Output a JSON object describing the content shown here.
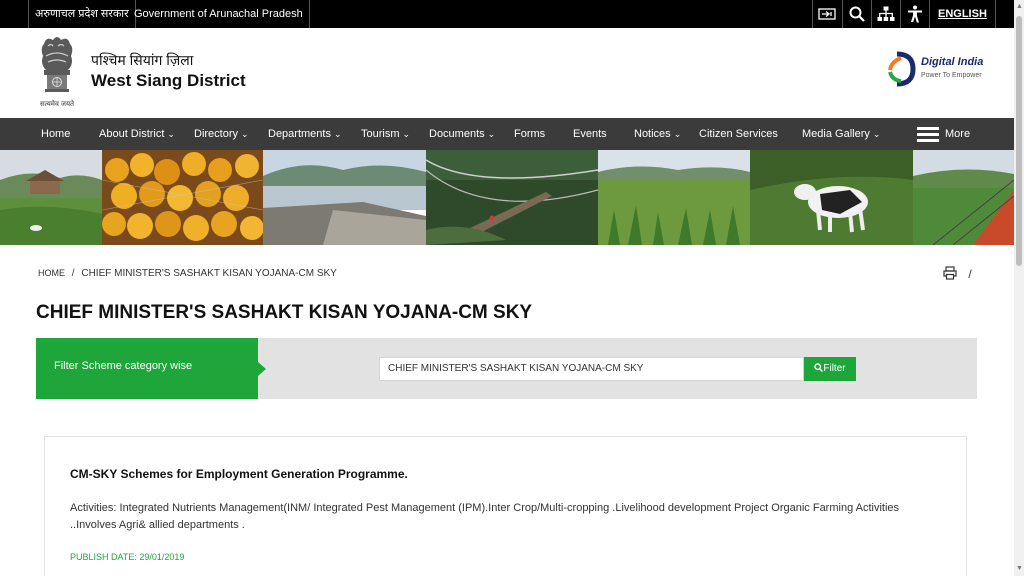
{
  "topbar": {
    "gov_hindi": "अरुणाचल प्रदेश सरकार",
    "gov_english": "Government of Arunachal Pradesh",
    "language": "ENGLISH",
    "tools": [
      "skip-to-content-icon",
      "search-icon",
      "sitemap-icon",
      "accessibility-icon"
    ]
  },
  "header": {
    "site_name_hindi": "पश्चिम सियांग ज़िला",
    "site_name_english": "West Siang District",
    "emblem_motto": "सत्यमेव जयते",
    "digital_india_title": "Digital India",
    "digital_india_tagline": "Power To Empower"
  },
  "nav": {
    "items": [
      {
        "label": "Home",
        "dropdown": false
      },
      {
        "label": "About District",
        "dropdown": true
      },
      {
        "label": "Directory",
        "dropdown": true
      },
      {
        "label": "Departments",
        "dropdown": true
      },
      {
        "label": "Tourism",
        "dropdown": true
      },
      {
        "label": "Documents",
        "dropdown": true
      },
      {
        "label": "Forms",
        "dropdown": false
      },
      {
        "label": "Events",
        "dropdown": false
      },
      {
        "label": "Notices",
        "dropdown": true
      },
      {
        "label": "Citizen Services",
        "dropdown": false
      },
      {
        "label": "Media Gallery",
        "dropdown": true
      }
    ],
    "more": "More",
    "chevron": "❯"
  },
  "breadcrumb": {
    "home": "HOME",
    "separator": "/",
    "current": "CHIEF MINISTER'S SASHAKT KISAN YOJANA-CM SKY"
  },
  "print_separator": "/",
  "page_title": "CHIEF MINISTER'S SASHAKT KISAN YOJANA-CM SKY",
  "filter": {
    "label": "Filter Scheme category wise",
    "value": "CHIEF MINISTER'S SASHAKT KISAN YOJANA-CM SKY",
    "button": "Filter"
  },
  "scheme": {
    "title": "CM-SKY Schemes for Employment Generation Programme.",
    "description": "Activities: Integrated Nutrients Management(INM/ Integrated Pest Management (IPM).Inter Crop/Multi-cropping .Livelihood development Project Organic Farming Activities ..Involves Agri& allied departments .",
    "publish_label": "PUBLISH DATE:",
    "publish_date": "29/01/2019"
  },
  "colors": {
    "topbar": "#000000",
    "nav": "#3b3b3b",
    "accent_green": "#1ea63b",
    "filter_bg": "#e2e2e2"
  }
}
